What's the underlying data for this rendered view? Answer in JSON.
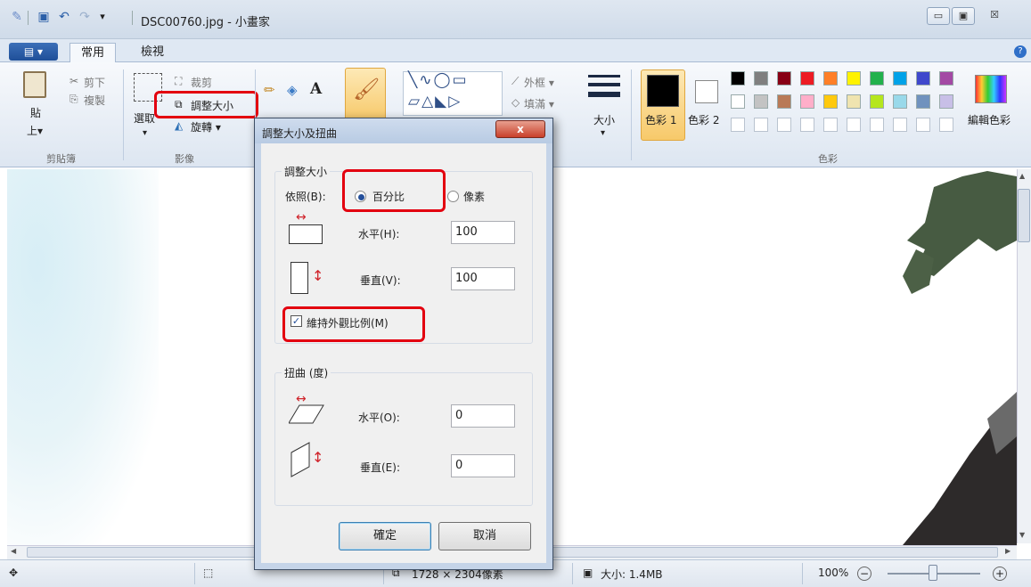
{
  "window": {
    "title": "DSC00760.jpg - 小畫家",
    "qa_dropdown": "▾",
    "controls": {
      "minimize": "▭",
      "maximize": "▣",
      "close": "☒"
    }
  },
  "ribbon": {
    "menu_button": "▤ ▾",
    "tabs": [
      "常用",
      "檢視"
    ],
    "help": "?",
    "clipboard": {
      "paste_label_1": "貼",
      "paste_label_2": "上▾",
      "cut": "剪下",
      "copy": "複製",
      "group": "剪貼簿"
    },
    "image": {
      "select": "選取",
      "select_arrow": "▾",
      "crop": "裁剪",
      "resize": "調整大小",
      "rotate": "旋轉 ▾",
      "group": "影像"
    },
    "tools": {
      "text_tool": "A"
    },
    "shapes": {
      "outline": "外框 ▾",
      "fill": "填滿 ▾"
    },
    "size": {
      "label": "大小",
      "arrow": "▾"
    },
    "colors": {
      "color1": "色彩 1",
      "color2": "色彩 2",
      "edit": "編輯色彩",
      "group": "色彩",
      "swatches_row1": [
        "#000000",
        "#7f7f7f",
        "#880015",
        "#ed1c24",
        "#ff7f27",
        "#fff200",
        "#22b14c",
        "#00a2e8",
        "#3f48cc",
        "#a349a4"
      ],
      "swatches_row2": [
        "#ffffff",
        "#c3c3c3",
        "#b97a57",
        "#ffaec9",
        "#ffc90e",
        "#efe4b0",
        "#b5e61d",
        "#99d9ea",
        "#7092be",
        "#c8bfe7"
      ]
    }
  },
  "dialog": {
    "title": "調整大小及扭曲",
    "close": "x",
    "resize_section": "調整大小",
    "by_label": "依照(B):",
    "by_percent": "百分比",
    "by_pixels": "像素",
    "horizontal_label": "水平(H):",
    "horizontal_value": "100",
    "vertical_label": "垂直(V):",
    "vertical_value": "100",
    "keep_aspect": "維持外觀比例(M)",
    "keep_aspect_checked": true,
    "skew_section": "扭曲 (度)",
    "skew_h_label": "水平(O):",
    "skew_h_value": "0",
    "skew_v_label": "垂直(E):",
    "skew_v_value": "0",
    "ok": "確定",
    "cancel": "取消"
  },
  "statusbar": {
    "dimensions": "1728 × 2304像素",
    "filesize": "大小: 1.4MB",
    "zoom": "100%",
    "zoom_out": "−",
    "zoom_in": "+"
  }
}
